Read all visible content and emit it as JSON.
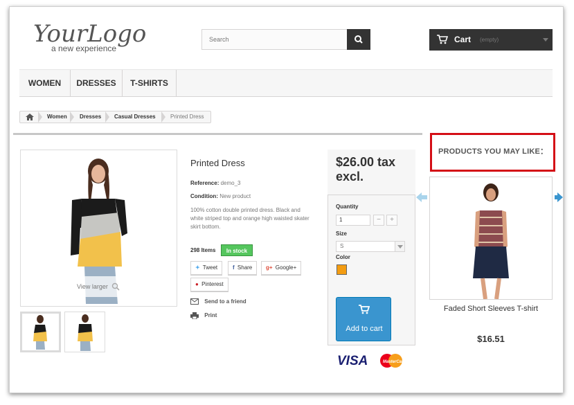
{
  "logo": {
    "main": "YourLogo",
    "tagline": "a new experience"
  },
  "search": {
    "placeholder": "Search"
  },
  "cart": {
    "label": "Cart",
    "status": "(empty)"
  },
  "menu": {
    "items": [
      "WOMEN",
      "DRESSES",
      "T-SHIRTS"
    ]
  },
  "breadcrumb": {
    "items": [
      "Women",
      "Dresses",
      "Casual Dresses"
    ],
    "current": "Printed Dress"
  },
  "product": {
    "title": "Printed Dress",
    "reference_label": "Reference:",
    "reference_value": "demo_3",
    "condition_label": "Condition:",
    "condition_value": "New product",
    "description": "100% cotton double printed dress. Black and white striped top and orange high waisted skater skirt bottom.",
    "items_count": "298 Items",
    "stock_status": "In stock",
    "view_larger": "View larger",
    "share_buttons": {
      "tweet": "Tweet",
      "share": "Share",
      "google": "Google+",
      "pinterest": "Pinterest"
    },
    "send_to_friend": "Send to a friend",
    "print": "Print"
  },
  "buy": {
    "price": "$26.00 tax excl.",
    "quantity_label": "Quantity",
    "quantity_value": "1",
    "minus": "−",
    "plus": "+",
    "size_label": "Size",
    "size_value": "S",
    "color_label": "Color",
    "color_value": "#f39c11",
    "add_to_cart": "Add to cart",
    "payment_visa": "VISA",
    "payment_mc": "MasterCard"
  },
  "recommendations": {
    "title": "PRODUCTS YOU MAY LIKE：",
    "items": [
      {
        "name": "Faded Short Sleeves T-shirt",
        "price": "$16.51"
      }
    ]
  },
  "colors": {
    "accent": "#3a95cf",
    "stock": "#55c65e",
    "highlight": "#d40e16",
    "dark": "#333333"
  },
  "icons": [
    "search-icon",
    "cart-icon",
    "home-icon",
    "magnifier-icon",
    "twitter-icon",
    "facebook-icon",
    "google-plus-icon",
    "pinterest-icon",
    "envelope-icon",
    "printer-icon",
    "arrow-left-icon",
    "arrow-right-icon"
  ]
}
